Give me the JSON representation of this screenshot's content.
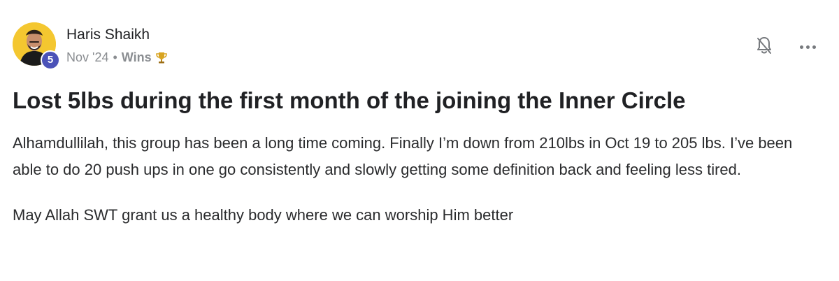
{
  "post": {
    "author": {
      "name": "Haris Shaikh",
      "level": "5",
      "avatar_bg": "#f4c730"
    },
    "meta": {
      "date": "Nov '24",
      "separator": "•",
      "category": "Wins",
      "category_icon": "trophy-icon"
    },
    "actions": {
      "bell_icon": "bell-off-icon",
      "more_icon": "more-horizontal-icon"
    },
    "title": "Lost 5lbs during the first month of the joining the Inner Circle",
    "body": [
      "Alhamdullilah, this group has been a long time coming. Finally I’m down from 210lbs in Oct 19 to 205 lbs. I’ve been able to do 20 push ups in one go consistently and slowly getting some definition back and feeling less tired.",
      "May Allah SWT grant us a healthy body where we can worship Him better"
    ],
    "colors": {
      "level_badge": "#4b52b8",
      "muted_text": "#8a8d91",
      "title_text": "#202124"
    }
  }
}
